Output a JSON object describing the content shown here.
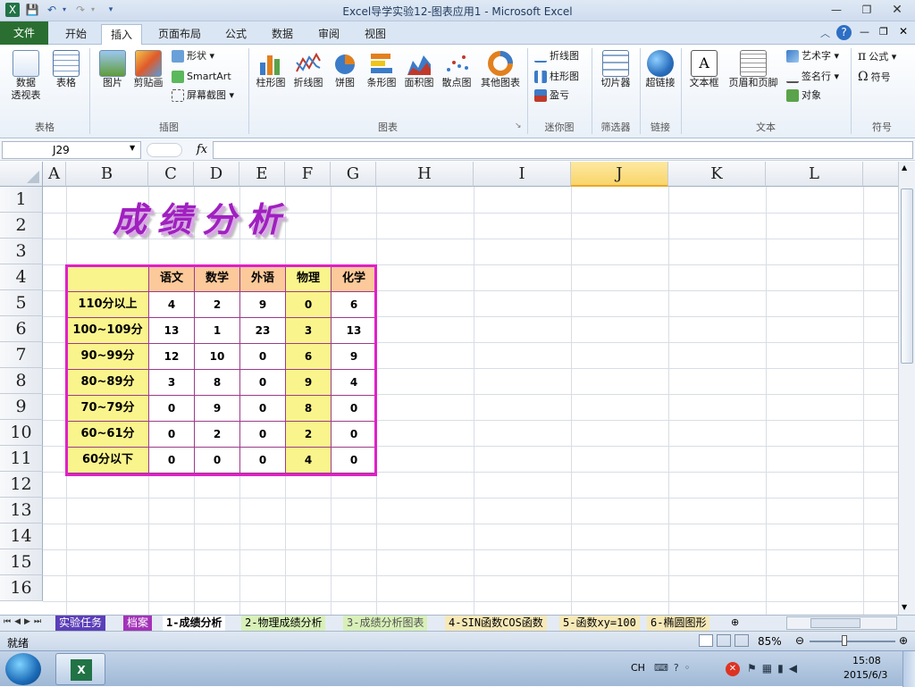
{
  "window": {
    "title": "Excel导学实验12-图表应用1 - Microsoft Excel"
  },
  "tabs": [
    "文件",
    "开始",
    "插入",
    "页面布局",
    "公式",
    "数据",
    "审阅",
    "视图"
  ],
  "ribbon": {
    "groups": {
      "tables": "表格",
      "illustrations": "插图",
      "charts": "图表",
      "sparklines": "迷你图",
      "filter": "筛选器",
      "links": "链接",
      "text": "文本",
      "symbols": "符号"
    },
    "pivot_label": "数据\n透视表",
    "table_label": "表格",
    "picture_label": "图片",
    "clipart_label": "剪贴画",
    "shapes_label": "形状",
    "smartart_label": "SmartArt",
    "screenshot_label": "屏幕截图",
    "column_label": "柱形图",
    "line_label": "折线图",
    "pie_label": "饼图",
    "bar_label": "条形图",
    "area_label": "面积图",
    "scatter_label": "散点图",
    "other_label": "其他图表",
    "spark_line": "折线图",
    "spark_column": "柱形图",
    "spark_winloss": "盈亏",
    "slicer_label": "切片器",
    "hyperlink_label": "超链接",
    "textbox_label": "文本框",
    "headerfooter_label": "页眉和页脚",
    "wordart_label": "艺术字",
    "signature_label": "签名行",
    "object_label": "对象",
    "equation_label": "公式",
    "symbol_label": "符号"
  },
  "formula_bar": {
    "name_box": "J29",
    "fx": "fx",
    "value": ""
  },
  "columns": [
    "A",
    "B",
    "C",
    "D",
    "E",
    "F",
    "G",
    "H",
    "I",
    "J",
    "K",
    "L"
  ],
  "rows": [
    "1",
    "2",
    "3",
    "4",
    "5",
    "6",
    "7",
    "8",
    "9",
    "10",
    "11",
    "12",
    "13",
    "14",
    "15",
    "16"
  ],
  "sheet": {
    "wordart_title": "成绩分析",
    "header": [
      "",
      "语文",
      "数学",
      "外语",
      "物理",
      "化学"
    ],
    "table": [
      [
        "110分以上",
        "4",
        "2",
        "9",
        "0",
        "6"
      ],
      [
        "100~109分",
        "13",
        "1",
        "23",
        "3",
        "13"
      ],
      [
        "90~99分",
        "12",
        "10",
        "0",
        "6",
        "9"
      ],
      [
        "80~89分",
        "3",
        "8",
        "0",
        "9",
        "4"
      ],
      [
        "70~79分",
        "0",
        "9",
        "0",
        "8",
        "0"
      ],
      [
        "60~61分",
        "0",
        "2",
        "0",
        "2",
        "0"
      ],
      [
        "60分以下",
        "0",
        "0",
        "0",
        "4",
        "0"
      ]
    ]
  },
  "sheet_tabs": [
    "实验任务",
    "档案",
    "1-成绩分析",
    "2-物理成绩分析",
    "3-成绩分析图表",
    "4-SIN函数COS函数",
    "5-函数xy=100",
    "6-椭圆图形"
  ],
  "status": {
    "ready": "就绪",
    "zoom": "85%"
  },
  "taskbar": {
    "lang": "CH",
    "time": "15:08",
    "date": "2015/6/3"
  },
  "colors": {
    "title_fill": "#f9f48c",
    "table_border": "#e020c8",
    "header_orange": "#fbc99a",
    "wordart": "#a020c0"
  }
}
